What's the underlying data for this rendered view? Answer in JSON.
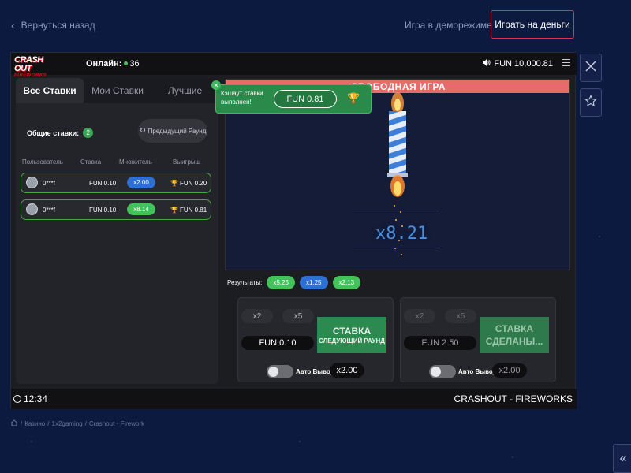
{
  "topbar": {
    "back_label": "Вернуться назад",
    "demo_label": "Игра в деморежиме",
    "real_label": "Играть на деньги"
  },
  "game": {
    "logo_main": "CRASH OUT",
    "logo_sub": "FIREWORKS",
    "online_label": "Онлайн:",
    "online_count": "36",
    "balance": "FUN 10,000.81"
  },
  "left_panel": {
    "tabs": [
      {
        "label": "Все Ставки",
        "active": true
      },
      {
        "label": "Мои Ставки",
        "active": false
      },
      {
        "label": "Лучшие",
        "active": false
      }
    ],
    "total_label": "Общие ставки:",
    "total_count": "2",
    "prev_round_label": "Предыдущий Раунд",
    "columns": [
      "Пользователь",
      "Ставка",
      "Множитель",
      "Выигрыш"
    ],
    "rows": [
      {
        "user": "0***f",
        "stake": "FUN 0.10",
        "mult": "x2.00",
        "mult_color": "#2d6fd2",
        "win": "FUN 0.20"
      },
      {
        "user": "0***f",
        "stake": "FUN 0.10",
        "mult": "x8.14",
        "mult_color": "#44c25a",
        "win": "FUN 0.81"
      }
    ]
  },
  "stage": {
    "header": "СВОБОДНАЯ ИГРА",
    "multiplier": "x8.21",
    "toast": {
      "message": "Кэшаут ставки выполнен!",
      "amount": "FUN 0.81"
    }
  },
  "results": {
    "label": "Результаты:",
    "items": [
      {
        "value": "x5.25",
        "color": "green"
      },
      {
        "value": "x1.25",
        "color": "blue"
      },
      {
        "value": "x2.13",
        "color": "green"
      }
    ]
  },
  "bet_panels": [
    {
      "q1": "x2",
      "q2": "x5",
      "amount": "FUN 0.10",
      "btn_title": "СТАВКА",
      "btn_sub": "СЛЕДУЮЩИЙ РАУНД",
      "auto_label": "Авто Вывод",
      "auto_value": "x2.00"
    },
    {
      "q1": "x2",
      "q2": "x5",
      "amount": "FUN 2.50",
      "btn_title": "СТАВКА СДЕЛАНЫ...",
      "btn_sub": "",
      "auto_label": "Авто Вывод",
      "auto_value": "x2.00"
    }
  ],
  "footer": {
    "time": "12:34",
    "game_name": "CRASHOUT - FIREWORKS"
  },
  "breadcrumbs": [
    "Казино",
    "1x2gaming",
    "Crashout - Firework"
  ],
  "colors": {
    "accent_red": "#e2304b",
    "green": "#44c25a",
    "blue": "#2d6fd2"
  }
}
